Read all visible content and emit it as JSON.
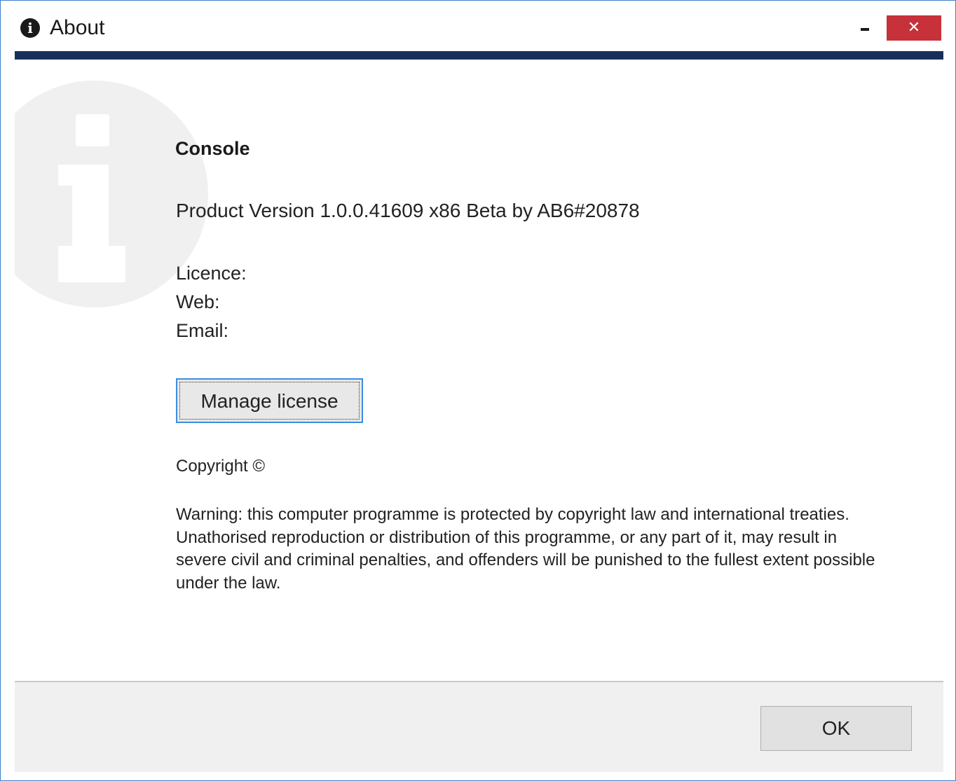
{
  "window": {
    "title": "About",
    "title_icon": "info-icon",
    "minimize_icon": "minimize-icon",
    "close_icon": "close-icon",
    "close_glyph": "✕",
    "accent_color": "#17305a",
    "close_color": "#c7313a"
  },
  "product": {
    "name": "Console",
    "version_line": "Product Version 1.0.0.41609 x86 Beta by AB6#20878"
  },
  "info": {
    "licence_label": "Licence:",
    "web_label": "Web:",
    "email_label": "Email:"
  },
  "actions": {
    "manage_license_label": "Manage license",
    "ok_label": "OK"
  },
  "legal": {
    "copyright": "Copyright ©",
    "warning": "Warning: this computer programme is protected by copyright law and international treaties. Unathorised reproduction or distribution of this programme, or any part of it, may result in severe civil and criminal penalties, and offenders will be punished to the fullest extent possible under the law."
  }
}
